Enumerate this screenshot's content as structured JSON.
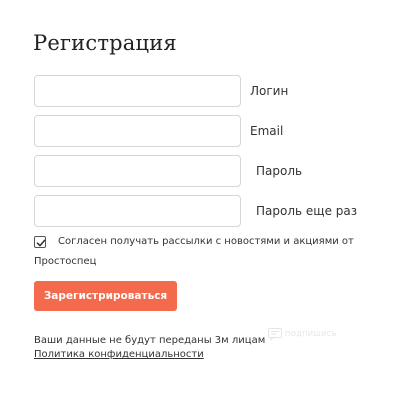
{
  "form": {
    "title": "Регистрация",
    "fields": [
      {
        "label": "Логин",
        "value": "",
        "placeholder": ""
      },
      {
        "label": "Email",
        "value": "",
        "placeholder": ""
      },
      {
        "label": "Пароль",
        "value": "",
        "placeholder": ""
      },
      {
        "label": "Пароль еще раз",
        "value": "",
        "placeholder": ""
      }
    ],
    "consent": {
      "checked": true,
      "text_line1": "Согласен получать рассылки с новостями и акциями от",
      "text_line2": "Простоспец"
    },
    "submit_label": "Зарегистрироваться",
    "privacy_note": "Ваши данные не будут переданы 3м лицам",
    "privacy_link": "Политика конфиденциальности"
  },
  "watermark": {
    "text": "ПОДПИШИСЬ",
    "icon": "logo-icon"
  },
  "colors": {
    "accent": "#f36a4c",
    "input_border": "#d6d6d6",
    "text": "#333333"
  }
}
